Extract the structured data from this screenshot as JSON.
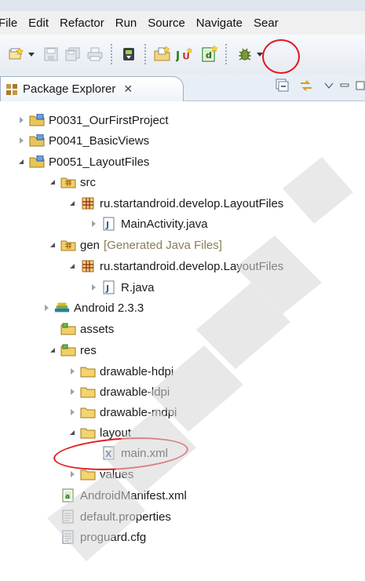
{
  "menubar": {
    "items": [
      {
        "label": "File"
      },
      {
        "label": "Edit"
      },
      {
        "label": "Refactor"
      },
      {
        "label": "Run"
      },
      {
        "label": "Source"
      },
      {
        "label": "Navigate"
      },
      {
        "label": "Sear"
      }
    ]
  },
  "toolbar": {
    "icons": [
      "new-icon",
      "save-icon",
      "save-all-icon",
      "print-icon",
      "android-sdk-icon",
      "new-project-icon",
      "new-junit-icon",
      "new-android-xml-icon",
      "debug-icon"
    ]
  },
  "view": {
    "tab_label": "Package Explorer",
    "close_glyph": "✕"
  },
  "tree": [
    {
      "label": "P0031_OurFirstProject",
      "decoration": "",
      "icon": "project-icon"
    },
    {
      "label": "P0041_BasicViews",
      "decoration": "",
      "icon": "project-icon"
    },
    {
      "label": "P0051_LayoutFiles",
      "decoration": "",
      "icon": "project-icon"
    },
    {
      "label": "src",
      "decoration": "",
      "icon": "source-folder-icon"
    },
    {
      "label": "ru.startandroid.develop.LayoutFiles",
      "decoration": "",
      "icon": "package-icon"
    },
    {
      "label": "MainActivity.java",
      "decoration": "",
      "icon": "java-file-icon"
    },
    {
      "label": "gen",
      "decoration": "[Generated Java Files]",
      "icon": "gen-folder-icon"
    },
    {
      "label": "ru.startandroid.develop.LayoutFiles",
      "decoration": "",
      "icon": "package-icon"
    },
    {
      "label": "R.java",
      "decoration": "",
      "icon": "java-file-icon"
    },
    {
      "label": "Android 2.3.3",
      "decoration": "",
      "icon": "library-icon"
    },
    {
      "label": "assets",
      "decoration": "",
      "icon": "folder-icon"
    },
    {
      "label": "res",
      "decoration": "",
      "icon": "folder-icon"
    },
    {
      "label": "drawable-hdpi",
      "decoration": "",
      "icon": "folder-icon"
    },
    {
      "label": "drawable-ldpi",
      "decoration": "",
      "icon": "folder-icon"
    },
    {
      "label": "drawable-mdpi",
      "decoration": "",
      "icon": "folder-icon"
    },
    {
      "label": "layout",
      "decoration": "",
      "icon": "folder-icon"
    },
    {
      "label": "main.xml",
      "decoration": "",
      "icon": "xml-file-icon"
    },
    {
      "label": "values",
      "decoration": "",
      "icon": "folder-icon"
    },
    {
      "label": "AndroidManifest.xml",
      "decoration": "",
      "icon": "manifest-icon"
    },
    {
      "label": "default.properties",
      "decoration": "",
      "icon": "text-file-icon"
    },
    {
      "label": "proguard.cfg",
      "decoration": "",
      "icon": "text-file-icon"
    }
  ],
  "colors": {
    "annotation": "#e2191f",
    "decoration": "#8b7d5a"
  }
}
